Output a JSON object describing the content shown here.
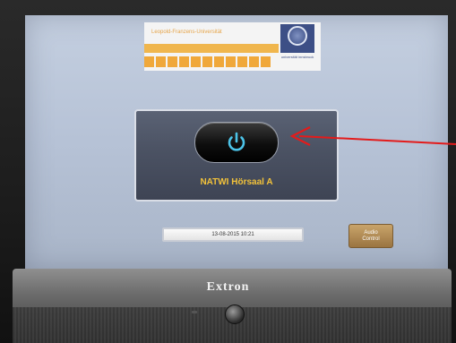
{
  "device": {
    "brand": "Extron"
  },
  "logo": {
    "institution_text": "Leopold-Franzens-Universität",
    "seal_text": "universität innsbruck"
  },
  "panel": {
    "power_icon": "power-icon",
    "room_name": "NATWI Hörsaal A"
  },
  "status": {
    "datetime": "13-08-2015 10:21"
  },
  "audio_control": {
    "label_line1": "Audio",
    "label_line2": "Control"
  },
  "colors": {
    "screen_bg": "#b6c2d6",
    "panel_bg": "#4b5263",
    "room_name": "#f2c23a",
    "power_icon": "#4cc3e8",
    "audio_button": "#b08a52",
    "annotation_arrow": "#e31b1b"
  }
}
